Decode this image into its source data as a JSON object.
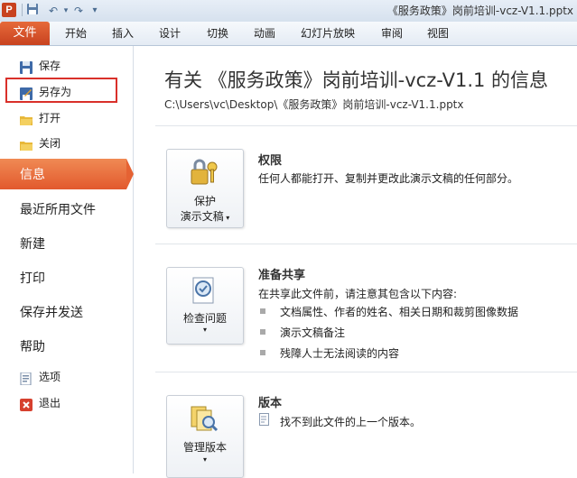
{
  "window": {
    "app_icon_letter": "P",
    "title": "《服务政策》岗前培训-vcz-V1.1.pptx"
  },
  "ribbon": {
    "file_tab": "文件",
    "tabs": [
      "开始",
      "插入",
      "设计",
      "切换",
      "动画",
      "幻灯片放映",
      "审阅",
      "视图"
    ]
  },
  "backstage_nav": {
    "commands": [
      {
        "label": "保存",
        "icon": "save-icon"
      },
      {
        "label": "另存为",
        "icon": "save-as-icon"
      },
      {
        "label": "打开",
        "icon": "open-folder-icon"
      },
      {
        "label": "关闭",
        "icon": "close-folder-icon"
      }
    ],
    "items": [
      "信息",
      "最近所用文件",
      "新建",
      "打印",
      "保存并发送",
      "帮助"
    ],
    "active_item": "信息",
    "footer_commands": [
      {
        "label": "选项",
        "icon": "options-icon"
      },
      {
        "label": "退出",
        "icon": "exit-icon"
      }
    ]
  },
  "info": {
    "title": "有关 《服务政策》岗前培训-vcz-V1.1 的信息",
    "path": "C:\\Users\\vc\\Desktop\\《服务政策》岗前培训-vcz-V1.1.pptx",
    "sections": {
      "permissions": {
        "button_line1": "保护",
        "button_line2": "演示文稿",
        "heading": "权限",
        "desc": "任何人都能打开、复制并更改此演示文稿的任何部分。"
      },
      "prepare": {
        "button_label": "检查问题",
        "heading": "准备共享",
        "desc": "在共享此文件前，请注意其包含以下内容:",
        "bullets": [
          "文档属性、作者的姓名、相关日期和裁剪图像数据",
          "演示文稿备注",
          "残障人士无法阅读的内容"
        ]
      },
      "versions": {
        "button_label": "管理版本",
        "heading": "版本",
        "desc": "找不到此文件的上一个版本。"
      }
    }
  },
  "colors": {
    "accent_orange": "#e2592d",
    "highlight_red": "#d9302a"
  }
}
